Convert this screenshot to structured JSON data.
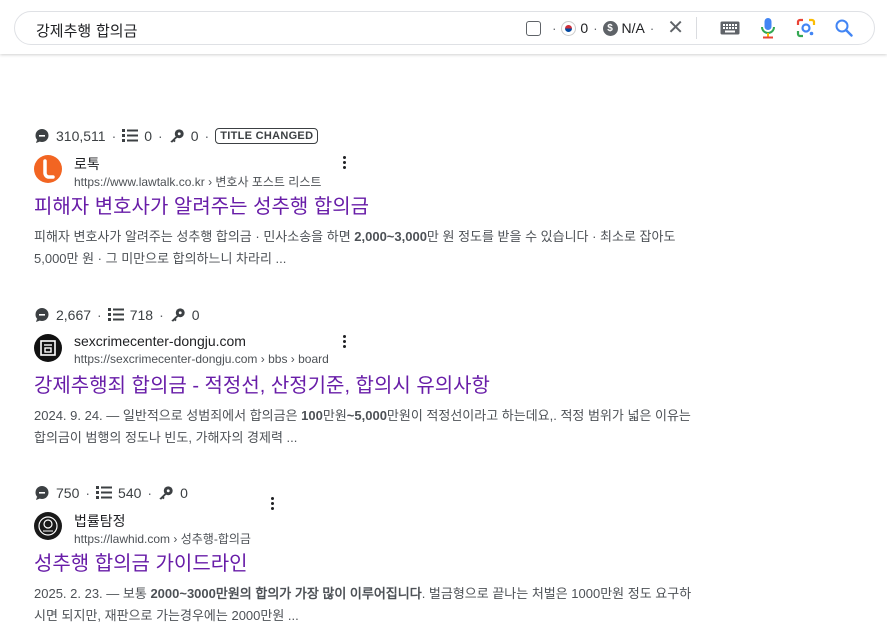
{
  "search": {
    "query": "강제추행 합의금",
    "flag_count": "0",
    "currency": "N/A"
  },
  "results": [
    {
      "views": "310,511",
      "list_count": "0",
      "key_count": "0",
      "badge": "TITLE CHANGED",
      "site_name": "로톡",
      "url": "https://www.lawtalk.co.kr",
      "breadcrumb": "› 변호사 포스트 리스트",
      "title": "피해자 변호사가 알려주는 성추행 합의금",
      "snippet": [
        {
          "t": "피해자 변호사가 알려주는 성추행 합의금 · 민사소송을 하면 ",
          "b": false
        },
        {
          "t": "2,000~3,000",
          "b": true
        },
        {
          "t": "만 원 정도를 받을 수 있습니다 · 최소로 잡아도 5,000만 원 · 그 미만으로 합의하느니 차라리 ...",
          "b": false
        }
      ]
    },
    {
      "views": "2,667",
      "list_count": "718",
      "key_count": "0",
      "site_name": "sexcrimecenter-dongju.com",
      "url": "https://sexcrimecenter-dongju.com",
      "breadcrumb": "› bbs › board",
      "title": "강제추행죄 합의금 - 적정선, 산정기준, 합의시 유의사항",
      "snippet": [
        {
          "t": "2024. 9. 24. — 일반적으로 성범죄에서 합의금은 ",
          "b": false
        },
        {
          "t": "100",
          "b": true
        },
        {
          "t": "만원",
          "b": false
        },
        {
          "t": "~5,000",
          "b": true
        },
        {
          "t": "만원이 적정선이라고 하는데요,. 적정 범위가 넓은 이유는 합의금이 범행의 정도나 빈도, 가해자의 경제력 ...",
          "b": false
        }
      ]
    },
    {
      "views": "750",
      "list_count": "540",
      "key_count": "0",
      "site_name": "법률탐정",
      "url": "https://lawhid.com",
      "breadcrumb": "› 성추행-합의금",
      "title": "성추행 합의금 가이드라인",
      "snippet": [
        {
          "t": "2025. 2. 23. — 보통 ",
          "b": false
        },
        {
          "t": "2000~3000",
          "b": true
        },
        {
          "t": "만원의 합의가 가장 많이 이루어집니다",
          "b": true
        },
        {
          "t": ". 벌금형으로 끝나는 처벌은 1000만원 정도 요구하시면 되지만, 재판으로 가는경우에는 2000만원 ...",
          "b": false
        }
      ]
    }
  ],
  "icons": [
    "comment-icon",
    "list-icon",
    "key-icon",
    "more-vert-icon",
    "keyboard-icon",
    "mic-icon",
    "lens-icon",
    "search-icon",
    "close-icon"
  ],
  "colors": {
    "title_link": "#681da8",
    "snippet": "#4d5156",
    "lawtalk_brand": "#f26522"
  }
}
